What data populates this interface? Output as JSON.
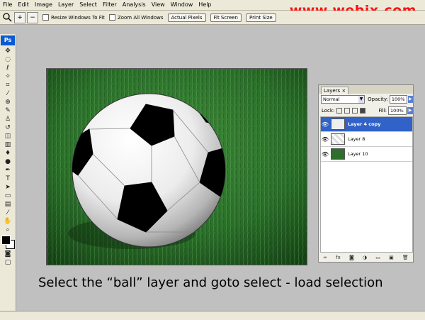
{
  "menubar": {
    "items": [
      "File",
      "Edit",
      "Image",
      "Layer",
      "Select",
      "Filter",
      "Analysis",
      "View",
      "Window",
      "Help"
    ]
  },
  "watermark": "www.webjx.com",
  "options_bar": {
    "zoom_in_icon": "+",
    "zoom_out_icon": "−",
    "checkbox_resize": "Resize Windows To Fit",
    "checkbox_zoom_all": "Zoom All Windows",
    "buttons": [
      "Actual Pixels",
      "Fit Screen",
      "Print Size"
    ]
  },
  "toolbox": {
    "logo": "Ps"
  },
  "layers_panel": {
    "tab_label": "Layers",
    "blend_mode": "Normal",
    "opacity_label": "Opacity:",
    "opacity_value": "100%",
    "lock_label": "Lock:",
    "fill_label": "Fill:",
    "fill_value": "100%",
    "layers": [
      {
        "name": "Layer 4 copy",
        "selected": true
      },
      {
        "name": "Layer 8",
        "selected": false
      },
      {
        "name": "Layer 10",
        "selected": false
      }
    ]
  },
  "caption": "Select the “ball” layer and goto select - load selection",
  "colors": {
    "chrome": "#ece9d8",
    "workspace": "#c0c0c0",
    "selection": "#3062c8",
    "watermark": "#ff1010"
  }
}
